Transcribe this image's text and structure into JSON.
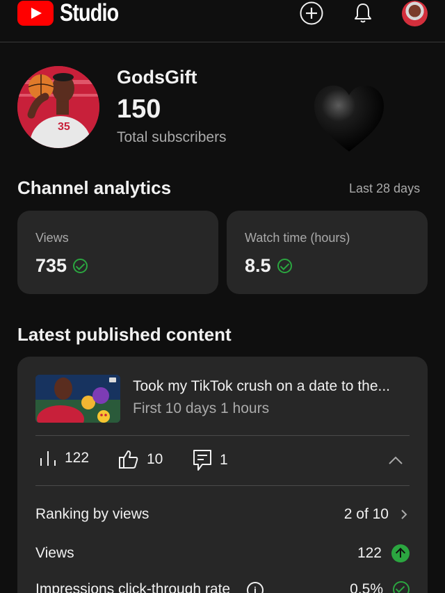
{
  "header": {
    "logo_text": "Studio",
    "icons": [
      "create-icon",
      "notifications-icon",
      "account-avatar"
    ]
  },
  "channel": {
    "name": "GodsGift",
    "subscribers": "150",
    "subscribers_label": "Total subscribers",
    "jersey_number": "35",
    "decoration": "black-heart"
  },
  "analytics": {
    "title": "Channel analytics",
    "range": "Last 28 days",
    "cards": [
      {
        "label": "Views",
        "value": "735"
      },
      {
        "label": "Watch time (hours)",
        "value": "8.5"
      }
    ]
  },
  "latest": {
    "title": "Latest published content",
    "video_title": "Took my TikTok crush on a date to the...",
    "video_subtitle": "First 10 days 1 hours",
    "metrics": {
      "views": "122",
      "likes": "10",
      "comments": "1"
    },
    "rows": [
      {
        "label": "Ranking by views",
        "value": "2 of 10"
      },
      {
        "label": "Views",
        "value": "122"
      },
      {
        "label": "Impressions click-through rate",
        "value": "0.5%"
      }
    ]
  },
  "colors": {
    "background": "#0f0f0f",
    "card": "#272727",
    "accent_red": "#ff0000",
    "success_green": "#2ba640",
    "muted_text": "#aaaaaa"
  }
}
